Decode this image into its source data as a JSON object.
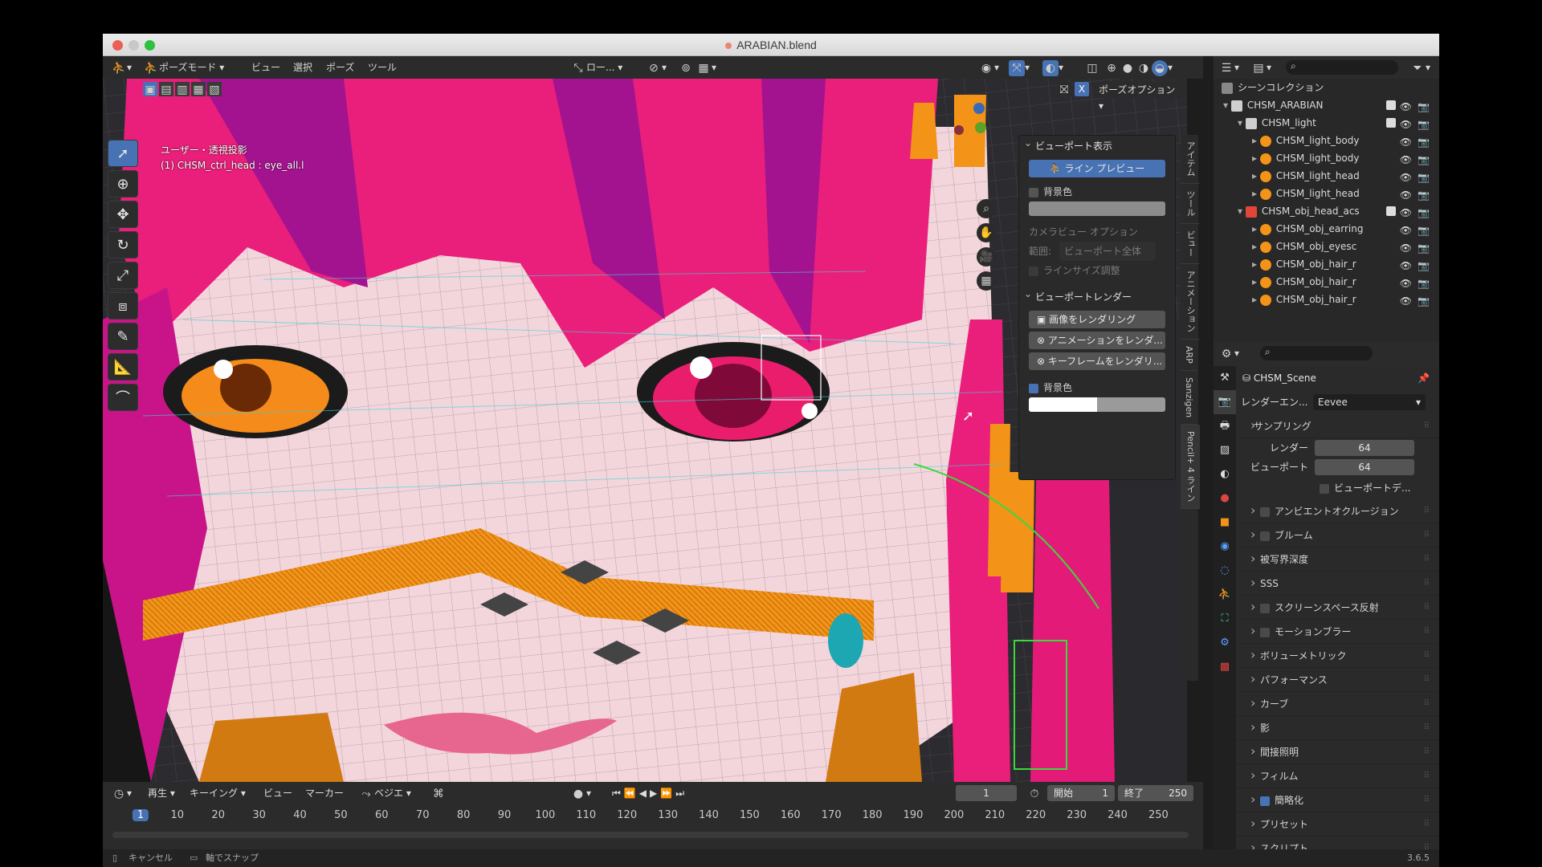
{
  "window": {
    "title": "ARABIAN.blend"
  },
  "header": {
    "mode": "ポーズモード",
    "menus": [
      "ビュー",
      "選択",
      "ポーズ",
      "ツール"
    ],
    "orientation": "ロー..."
  },
  "viewport": {
    "pose_options": "ポーズオプション",
    "info_line1": "ユーザー・透視投影",
    "info_line2": "(1) CHSM_ctrl_head : eye_all.l"
  },
  "npanel": {
    "section1": "ビューポート表示",
    "line_preview": "ライン プレビュー",
    "bg_color": "背景色",
    "camera_options": "カメラビュー オプション",
    "range_label": "範囲:",
    "range_value": "ビューポート全体",
    "line_size": "ラインサイズ調整",
    "section2": "ビューポートレンダー",
    "render_image": "画像をレンダリング",
    "render_anim": "アニメーションをレンダ...",
    "render_keyframe": "キーフレームをレンダリ...",
    "bg_color2": "背景色"
  },
  "vtabs": [
    "アイテム",
    "ツール",
    "ビュー",
    "アニメーション",
    "ARP",
    "Sanzigen",
    "Pencil+ 4 ライン"
  ],
  "outliner": {
    "root": "シーンコレクション",
    "items": [
      {
        "label": "CHSM_ARABIAN",
        "depth": 0,
        "icon": "collection"
      },
      {
        "label": "CHSM_light",
        "depth": 1,
        "icon": "collection"
      },
      {
        "label": "CHSM_light_body",
        "depth": 2,
        "icon": "light"
      },
      {
        "label": "CHSM_light_body",
        "depth": 2,
        "icon": "light-data"
      },
      {
        "label": "CHSM_light_head",
        "depth": 2,
        "icon": "light"
      },
      {
        "label": "CHSM_light_head",
        "depth": 2,
        "icon": "light-data"
      },
      {
        "label": "CHSM_obj_head_acs",
        "depth": 1,
        "icon": "collection-red"
      },
      {
        "label": "CHSM_obj_earring",
        "depth": 2,
        "icon": "mesh"
      },
      {
        "label": "CHSM_obj_eyesc",
        "depth": 2,
        "icon": "mesh"
      },
      {
        "label": "CHSM_obj_hair_r",
        "depth": 2,
        "icon": "mesh"
      },
      {
        "label": "CHSM_obj_hair_r",
        "depth": 2,
        "icon": "mesh"
      },
      {
        "label": "CHSM_obj_hair_r",
        "depth": 2,
        "icon": "mesh"
      }
    ]
  },
  "properties": {
    "scene": "CHSM_Scene",
    "engine_label": "レンダーエン...",
    "engine_value": "Eevee",
    "sampling": "サンプリング",
    "render_label": "レンダー",
    "render_value": "64",
    "viewport_label": "ビューポート",
    "viewport_value": "64",
    "viewport_denoise": "ビューポートデ...",
    "sections": [
      {
        "label": "アンビエントオクルージョン",
        "check": false
      },
      {
        "label": "ブルーム",
        "check": false
      },
      {
        "label": "被写界深度"
      },
      {
        "label": "SSS"
      },
      {
        "label": "スクリーンスペース反射",
        "check": false
      },
      {
        "label": "モーションブラー",
        "check": false
      },
      {
        "label": "ボリューメトリック"
      },
      {
        "label": "パフォーマンス"
      },
      {
        "label": "カーブ"
      },
      {
        "label": "影"
      },
      {
        "label": "間接照明"
      },
      {
        "label": "フィルム"
      },
      {
        "label": "簡略化",
        "check": true
      },
      {
        "label": "プリセット"
      },
      {
        "label": "スクリプト"
      }
    ]
  },
  "timeline": {
    "menus": [
      "再生",
      "キーイング",
      "ビュー",
      "マーカー"
    ],
    "interp": "ベジエ",
    "current": "1",
    "start_label": "開始",
    "start": "1",
    "end_label": "終了",
    "end": "250",
    "ticks": [
      "1",
      "10",
      "20",
      "30",
      "40",
      "50",
      "60",
      "70",
      "80",
      "90",
      "100",
      "110",
      "120",
      "130",
      "140",
      "150",
      "160",
      "170",
      "180",
      "190",
      "200",
      "210",
      "220",
      "230",
      "240",
      "250"
    ]
  },
  "status": {
    "cancel": "キャンセル",
    "snap": "軸でスナップ",
    "version": "3.6.5"
  }
}
